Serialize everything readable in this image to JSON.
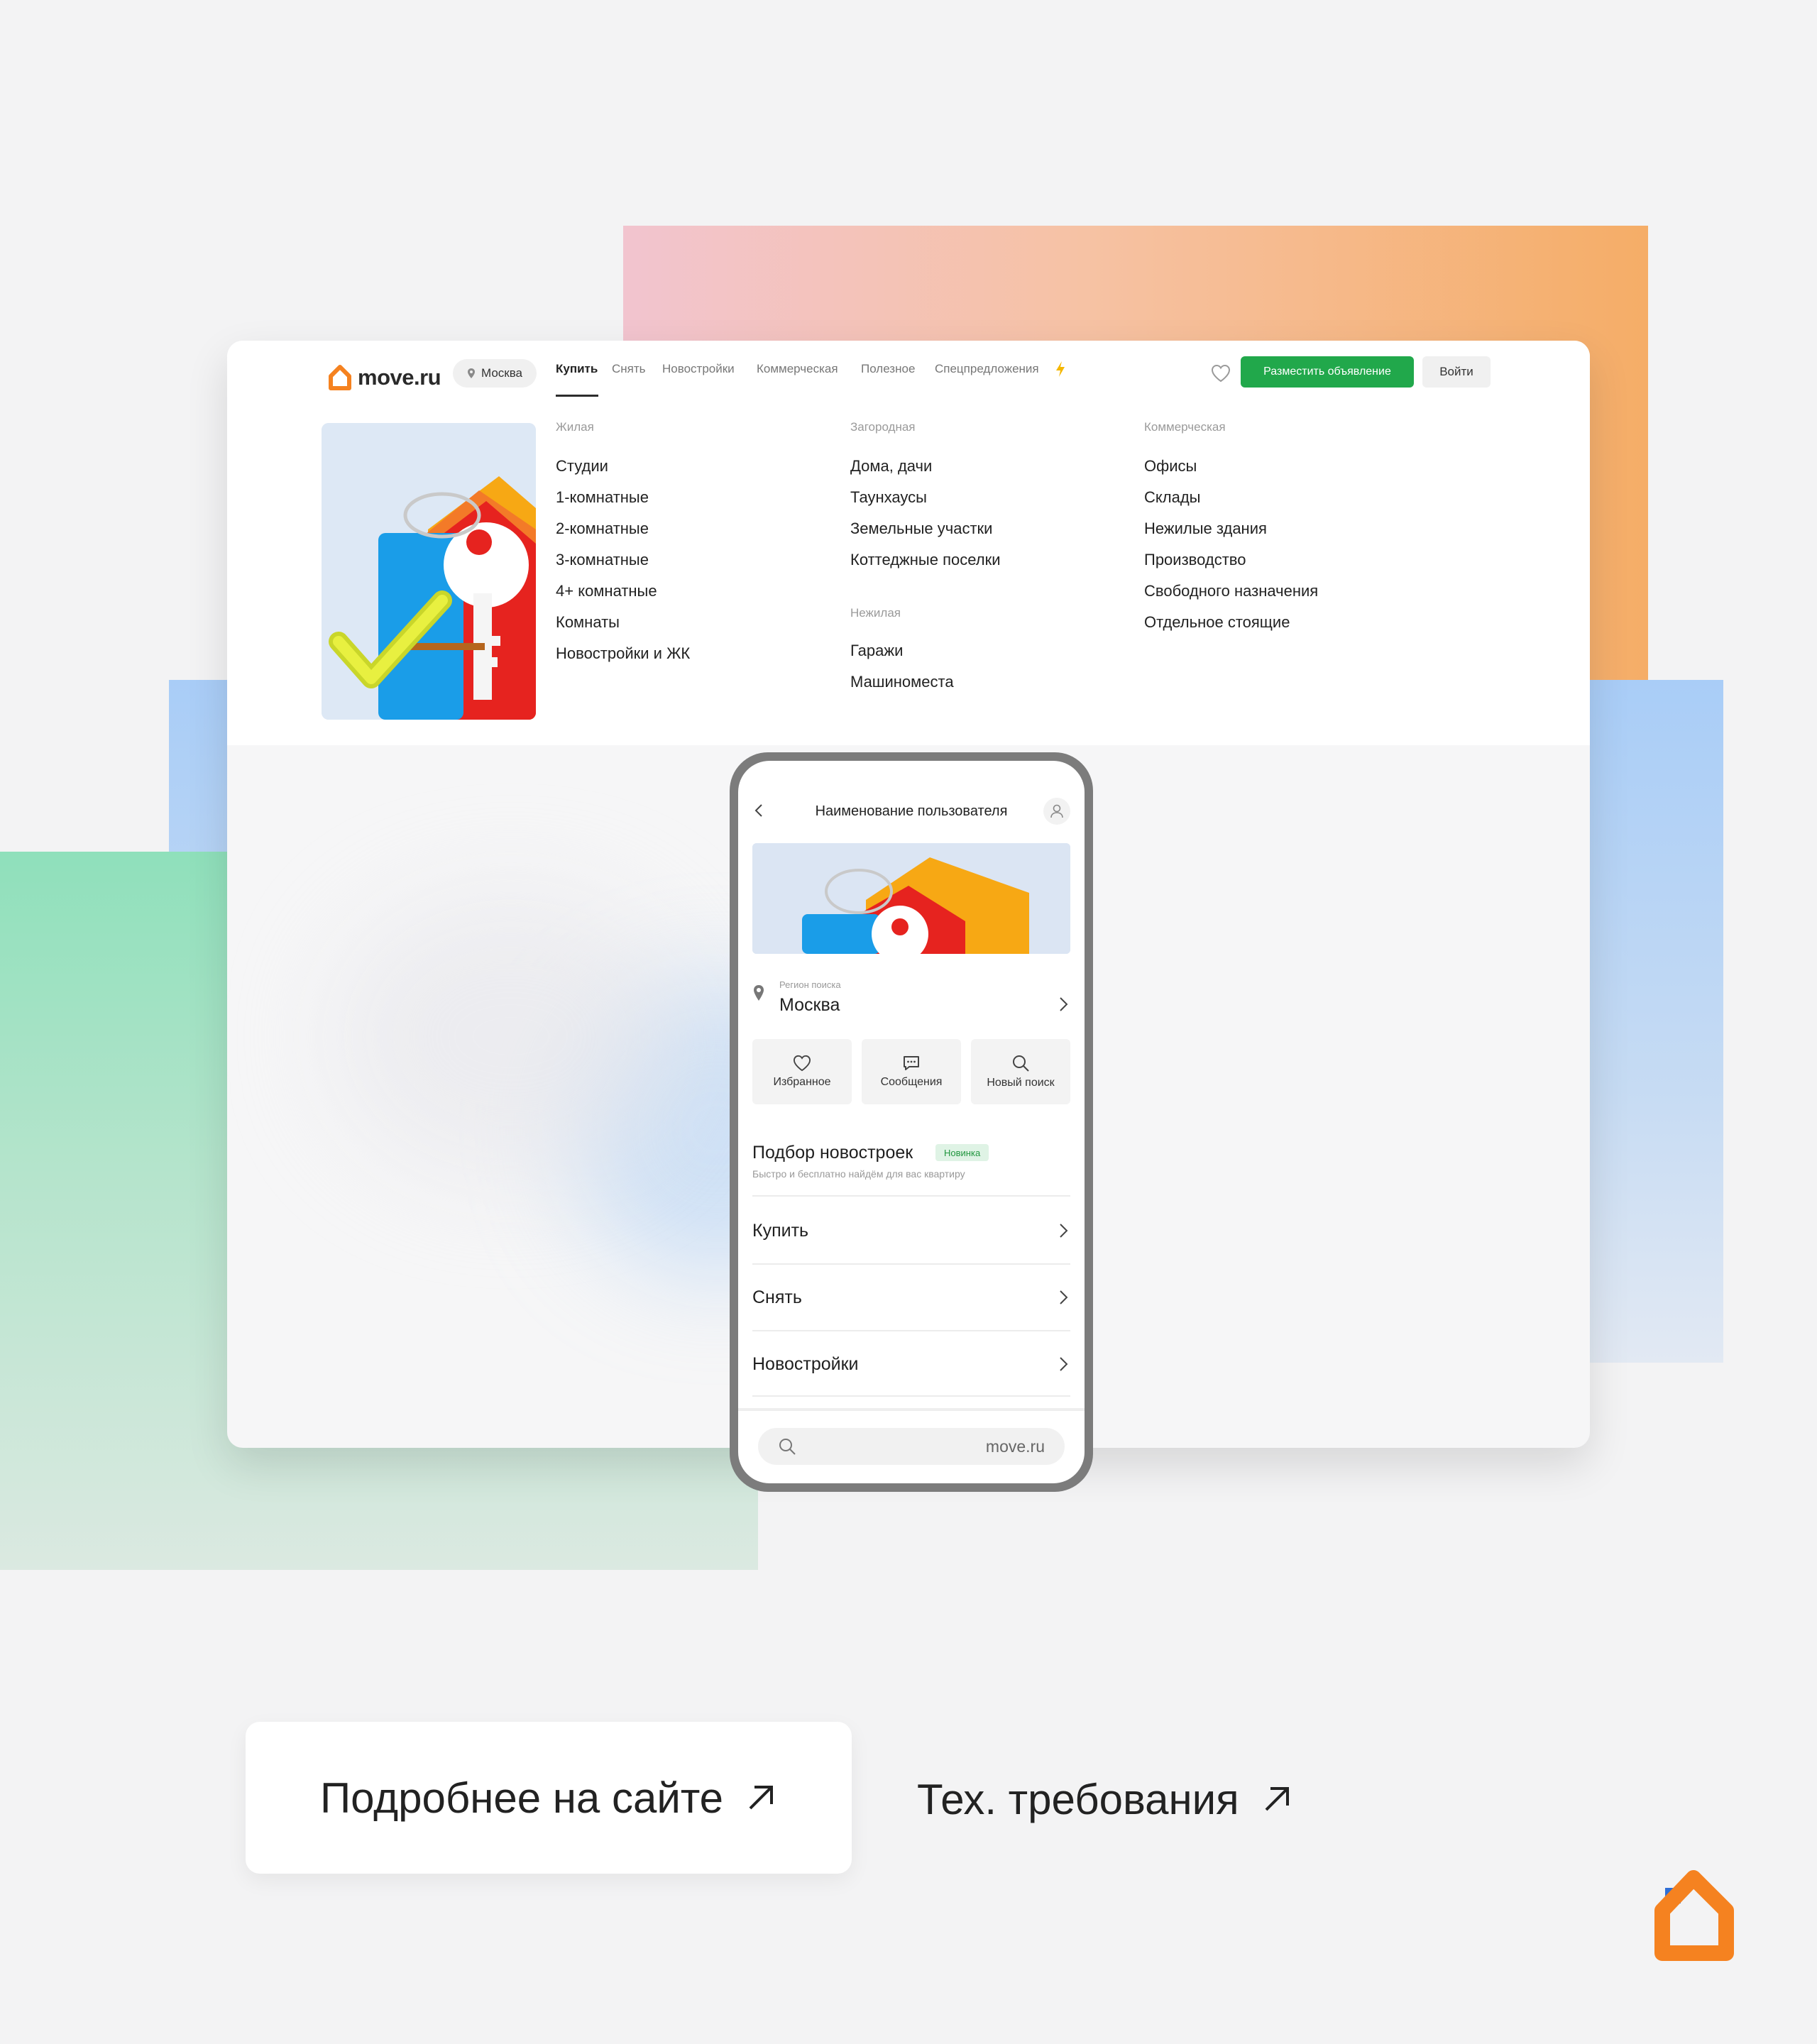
{
  "brand": {
    "logo_text": "move.ru",
    "accent": "#F58220",
    "green": "#21A84B"
  },
  "header": {
    "city": "Москва",
    "nav": [
      "Купить",
      "Снять",
      "Новостройки",
      "Коммерческая",
      "Полезное",
      "Спецпредложения"
    ],
    "post_ad_label": "Разместить объявление",
    "login_label": "Войти"
  },
  "menu": {
    "columns": [
      {
        "heading": "Жилая",
        "items": [
          "Студии",
          "1-комнатные",
          "2-комнатные",
          "3-комнатные",
          "4+ комнатные",
          "Комнаты",
          "Новостройки и ЖК"
        ]
      },
      {
        "heading": "Загородная",
        "items": [
          "Дома, дачи",
          "Таунхаусы",
          "Земельные участки",
          "Коттеджные поселки"
        ]
      },
      {
        "heading": "Нежилая",
        "items": [
          "Гаражи",
          "Машиноместа"
        ]
      },
      {
        "heading": "Коммерческая",
        "items": [
          "Офисы",
          "Склады",
          "Нежилые здания",
          "Производство",
          "Свободного назначения",
          "Отдельное стоящие"
        ]
      }
    ]
  },
  "phone": {
    "title": "Наименование пользователя",
    "region_label": "Регион поиска",
    "region_value": "Москва",
    "tiles": [
      "Избранное",
      "Сообщения",
      "Новый поиск"
    ],
    "pick_title": "Подбор новостроек",
    "pick_badge": "Новинка",
    "pick_subtitle": "Быстро и бесплатно найдём для вас квартиру",
    "rows": [
      "Купить",
      "Снять",
      "Новостройки"
    ],
    "search_text": "move.ru"
  },
  "cta": {
    "site_label": "Подробнее на сайте",
    "tech_label": "Тех. требования"
  }
}
